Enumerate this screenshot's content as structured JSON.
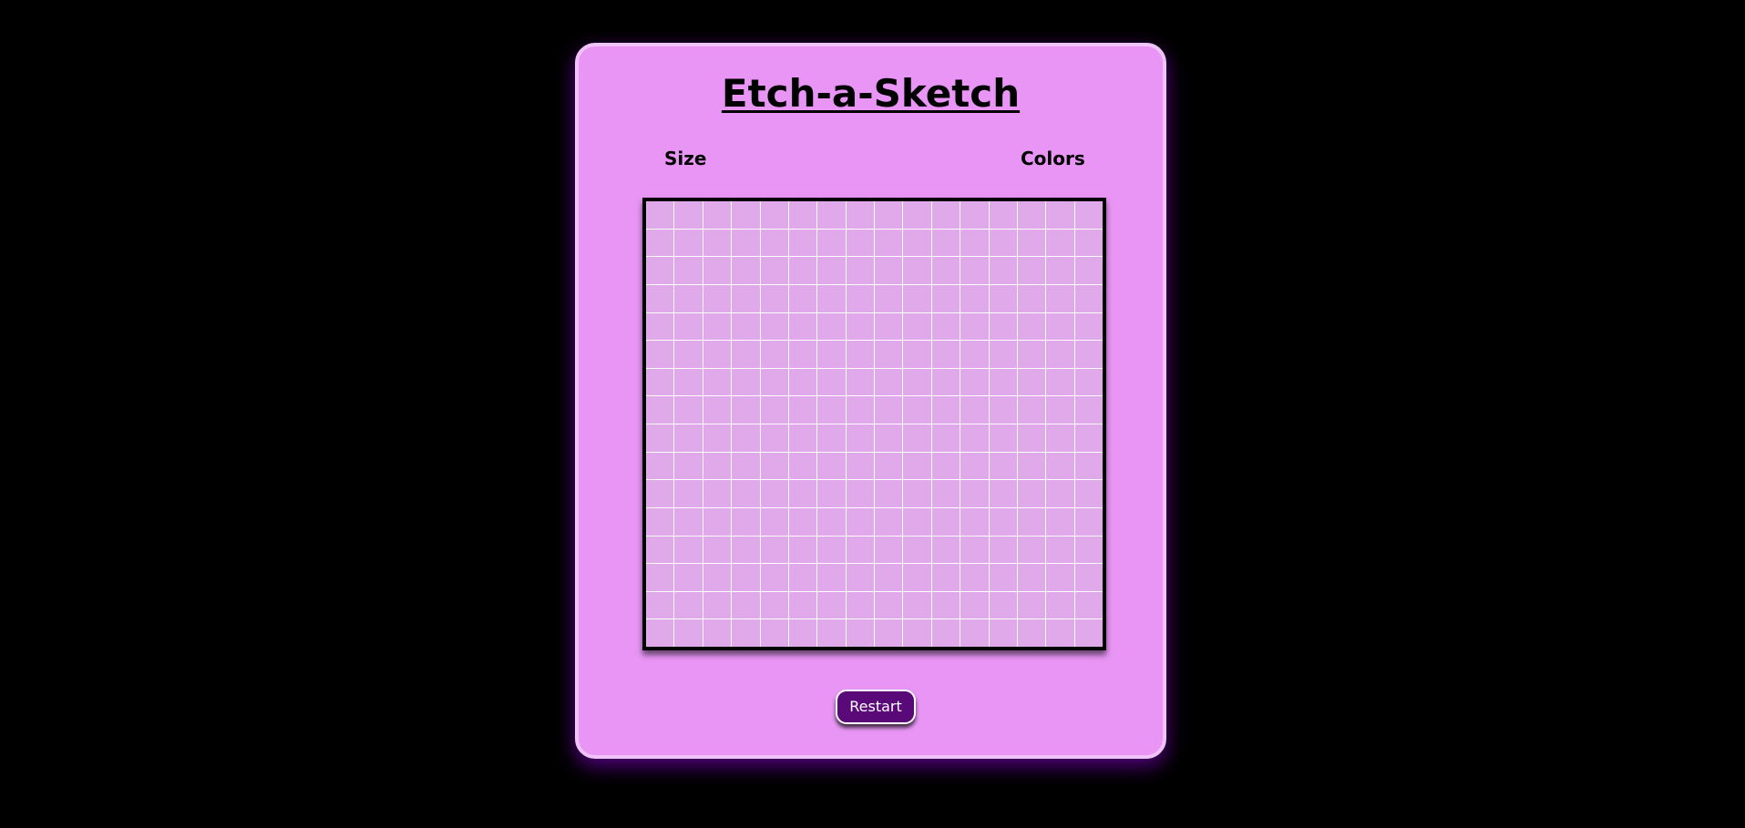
{
  "app": {
    "title": "Etch-a-Sketch"
  },
  "controls": {
    "size_label": "Size",
    "colors_label": "Colors"
  },
  "grid": {
    "rows": 16,
    "columns": 16
  },
  "actions": {
    "restart_label": "Restart"
  },
  "colors": {
    "page_background": "#000000",
    "card_background": "#e895f5",
    "card_border": "#f0c4f8",
    "cell_color": "#dfa9ea",
    "grid_lines": "#ffffff",
    "grid_border": "#000000",
    "button_background": "#5a0a78",
    "button_text": "#ffffff"
  }
}
